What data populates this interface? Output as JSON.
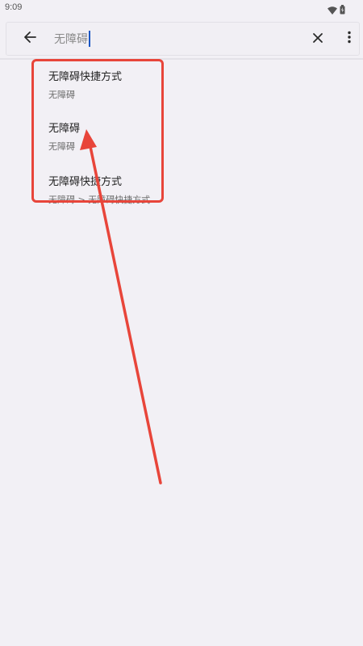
{
  "status_bar": {
    "time": "9:09",
    "icons": [
      "wifi-icon",
      "battery-icon"
    ]
  },
  "search_bar": {
    "query": "无障碍",
    "back_icon": "arrow-left-icon",
    "clear_icon": "close-icon",
    "more_icon": "more-vert-icon"
  },
  "results": [
    {
      "title": "无障碍快捷方式",
      "subtitle": "无障碍"
    },
    {
      "title": "无障碍",
      "subtitle": "无障碍"
    },
    {
      "title": "无障碍快捷方式",
      "subtitle": "无障碍 > 无障碍快捷方式"
    }
  ],
  "annotation": {
    "color": "#e8453a"
  }
}
